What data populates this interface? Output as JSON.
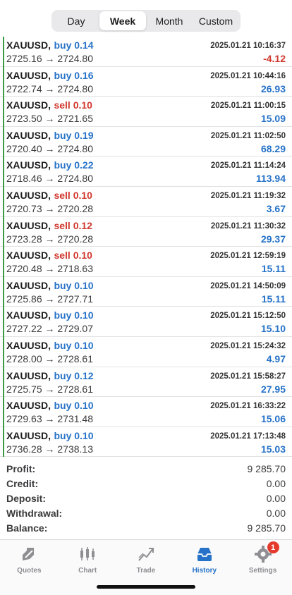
{
  "periods": [
    "Day",
    "Week",
    "Month",
    "Custom"
  ],
  "active_period": "Week",
  "trades": [
    {
      "symbol": "XAUUSD,",
      "side": "buy 0.14",
      "type": "buy",
      "time": "2025.01.21 10:16:37",
      "prices": "2725.16 → 2724.80",
      "profit": "-4.12",
      "neg": true
    },
    {
      "symbol": "XAUUSD,",
      "side": "buy 0.16",
      "type": "buy",
      "time": "2025.01.21 10:44:16",
      "prices": "2722.74 → 2724.80",
      "profit": "26.93",
      "neg": false
    },
    {
      "symbol": "XAUUSD,",
      "side": "sell 0.10",
      "type": "sell",
      "time": "2025.01.21 11:00:15",
      "prices": "2723.50 → 2721.65",
      "profit": "15.09",
      "neg": false
    },
    {
      "symbol": "XAUUSD,",
      "side": "buy 0.19",
      "type": "buy",
      "time": "2025.01.21 11:02:50",
      "prices": "2720.40 → 2724.80",
      "profit": "68.29",
      "neg": false
    },
    {
      "symbol": "XAUUSD,",
      "side": "buy 0.22",
      "type": "buy",
      "time": "2025.01.21 11:14:24",
      "prices": "2718.46 → 2724.80",
      "profit": "113.94",
      "neg": false
    },
    {
      "symbol": "XAUUSD,",
      "side": "sell 0.10",
      "type": "sell",
      "time": "2025.01.21 11:19:32",
      "prices": "2720.73 → 2720.28",
      "profit": "3.67",
      "neg": false
    },
    {
      "symbol": "XAUUSD,",
      "side": "sell 0.12",
      "type": "sell",
      "time": "2025.01.21 11:30:32",
      "prices": "2723.28 → 2720.28",
      "profit": "29.37",
      "neg": false
    },
    {
      "symbol": "XAUUSD,",
      "side": "sell 0.10",
      "type": "sell",
      "time": "2025.01.21 12:59:19",
      "prices": "2720.48 → 2718.63",
      "profit": "15.11",
      "neg": false
    },
    {
      "symbol": "XAUUSD,",
      "side": "buy 0.10",
      "type": "buy",
      "time": "2025.01.21 14:50:09",
      "prices": "2725.86 → 2727.71",
      "profit": "15.11",
      "neg": false
    },
    {
      "symbol": "XAUUSD,",
      "side": "buy 0.10",
      "type": "buy",
      "time": "2025.01.21 15:12:50",
      "prices": "2727.22 → 2729.07",
      "profit": "15.10",
      "neg": false
    },
    {
      "symbol": "XAUUSD,",
      "side": "buy 0.10",
      "type": "buy",
      "time": "2025.01.21 15:24:32",
      "prices": "2728.00 → 2728.61",
      "profit": "4.97",
      "neg": false
    },
    {
      "symbol": "XAUUSD,",
      "side": "buy 0.12",
      "type": "buy",
      "time": "2025.01.21 15:58:27",
      "prices": "2725.75 → 2728.61",
      "profit": "27.95",
      "neg": false
    },
    {
      "symbol": "XAUUSD,",
      "side": "buy 0.10",
      "type": "buy",
      "time": "2025.01.21 16:33:22",
      "prices": "2729.63 → 2731.48",
      "profit": "15.06",
      "neg": false
    },
    {
      "symbol": "XAUUSD,",
      "side": "buy 0.10",
      "type": "buy",
      "time": "2025.01.21 17:13:48",
      "prices": "2736.28 → 2738.13",
      "profit": "15.03",
      "neg": false
    }
  ],
  "summary": [
    {
      "label": "Profit:",
      "value": "9 285.70"
    },
    {
      "label": "Credit:",
      "value": "0.00"
    },
    {
      "label": "Deposit:",
      "value": "0.00"
    },
    {
      "label": "Withdrawal:",
      "value": "0.00"
    },
    {
      "label": "Balance:",
      "value": "9 285.70"
    }
  ],
  "tabs": [
    {
      "label": "Quotes",
      "icon": "quotes-icon"
    },
    {
      "label": "Chart",
      "icon": "chart-icon"
    },
    {
      "label": "Trade",
      "icon": "trade-icon"
    },
    {
      "label": "History",
      "icon": "history-icon"
    },
    {
      "label": "Settings",
      "icon": "settings-icon",
      "badge": "1"
    }
  ],
  "active_tab": "History",
  "colors": {
    "buy": "#2672c8",
    "sell": "#d0382e",
    "accent": "#2672c8",
    "badge": "#e5392b",
    "deal_marker": "#3a9a44"
  }
}
